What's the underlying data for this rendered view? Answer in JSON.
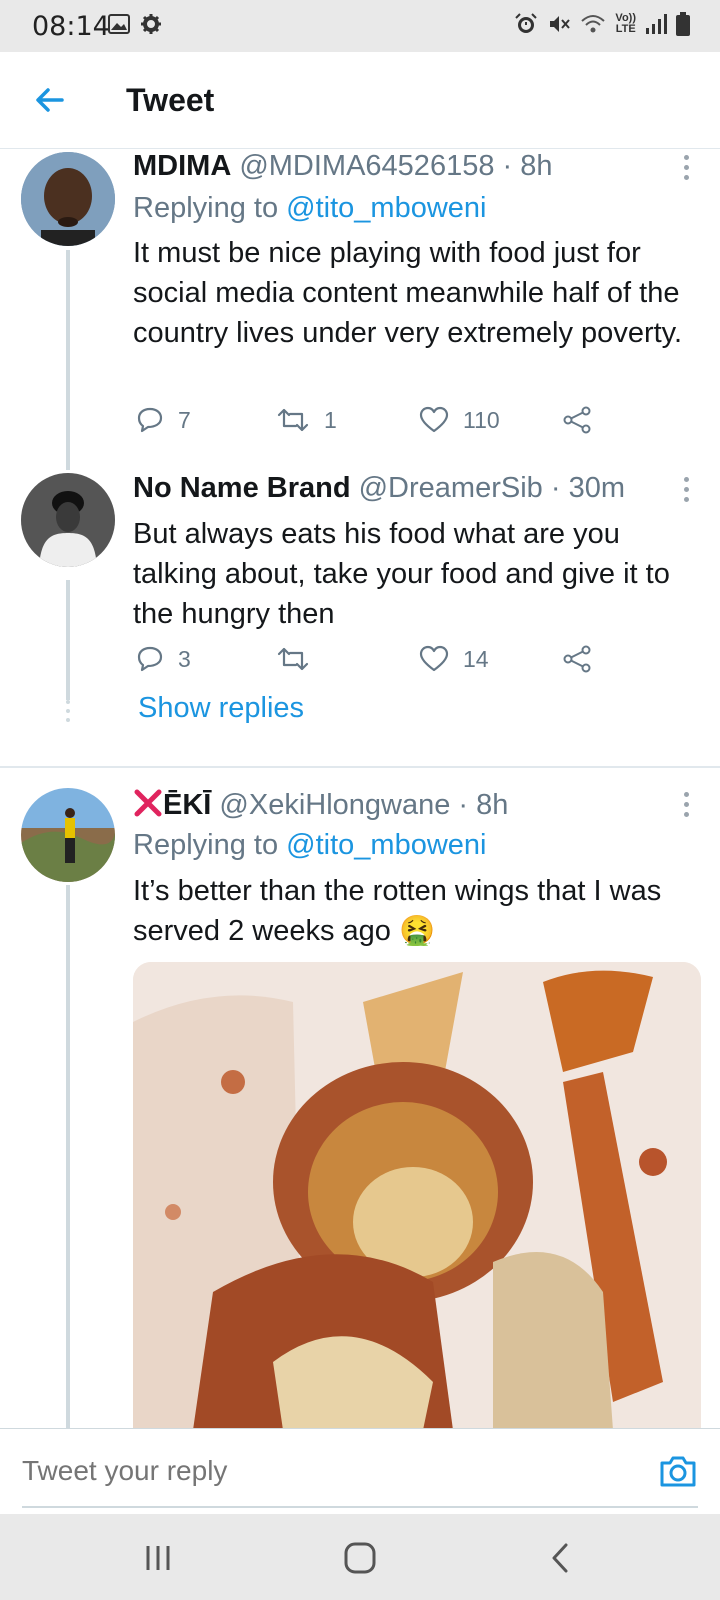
{
  "status_bar": {
    "time": "08:14",
    "left_icons": [
      "image-icon",
      "gear-icon"
    ],
    "right_icons": [
      "alarm-icon",
      "mute-icon",
      "wifi-icon",
      "volte-icon",
      "signal-icon",
      "battery-icon"
    ],
    "volte_label_top": "Vo))",
    "volte_label_bottom": "LTE"
  },
  "header": {
    "title": "Tweet",
    "back_icon": "arrow-left-icon"
  },
  "tweets": [
    {
      "name": "MDIMA",
      "handle": "@MDIMA64526158",
      "sep": "·",
      "time": "8h",
      "replying_prefix": "Replying to ",
      "replying_to": "@tito_mboweni",
      "text": "It must be nice playing with food just for social media content meanwhile half of the country lives under very extremely poverty.",
      "replies": "7",
      "retweets": "1",
      "likes": "110"
    },
    {
      "name": "No Name Brand",
      "handle": "@DreamerSib",
      "sep": "·",
      "time": "30m",
      "text": "But always eats his food what are you talking about, take your food and give it to the hungry then",
      "replies": "3",
      "retweets": "",
      "likes": "14"
    },
    {
      "name": "ĒKĪ",
      "name_prefix_icon": "red-x-icon",
      "handle": "@XekiHlongwane",
      "sep": "·",
      "time": "8h",
      "replying_prefix": "Replying to ",
      "replying_to": "@tito_mboweni",
      "text": "It’s better than the rotten wings that I was served 2 weeks ago",
      "emoji": "🤮",
      "media": "photo-of-chicken-wing-and-fries"
    }
  ],
  "show_replies": "Show replies",
  "reply_bar": {
    "placeholder": "Tweet your reply",
    "camera_icon": "camera-icon"
  },
  "nav_bar": {
    "buttons": [
      "recent-apps-icon",
      "home-icon",
      "back-icon"
    ]
  },
  "colors": {
    "accent": "#1b95e0",
    "muted": "#657786",
    "text": "#14171a",
    "x_red": "#e0245e"
  }
}
